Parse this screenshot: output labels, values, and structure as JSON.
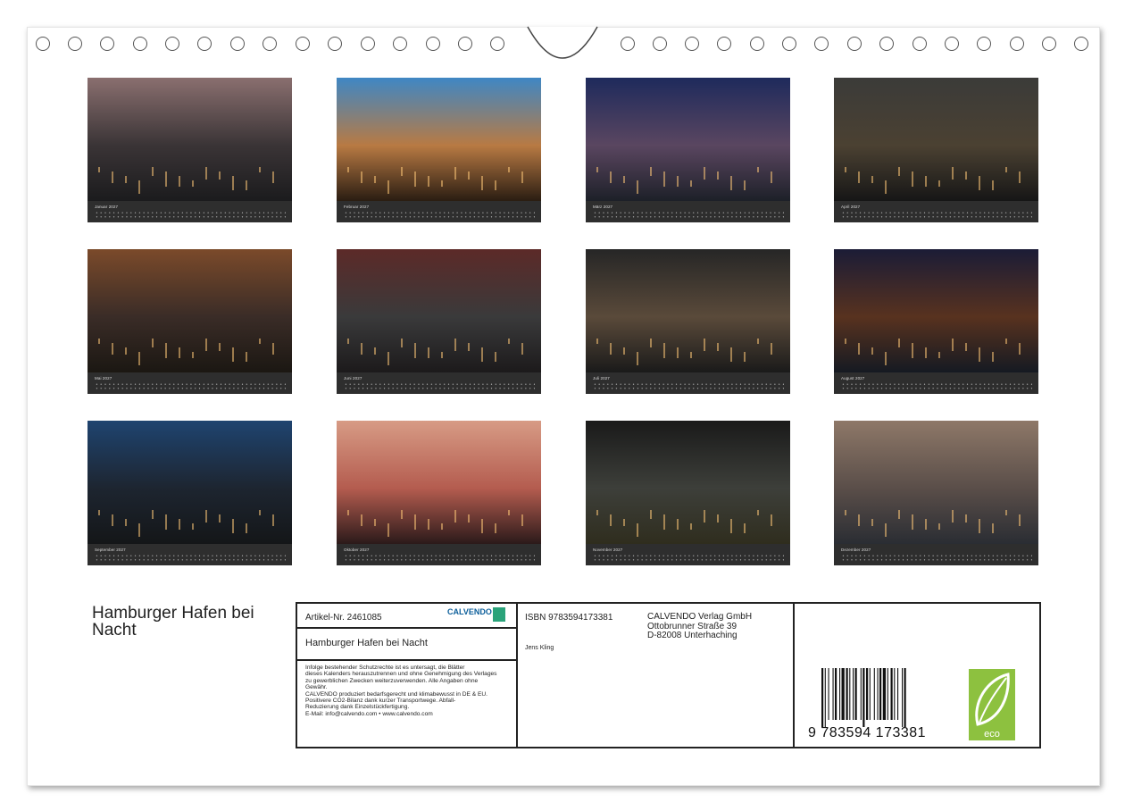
{
  "document_title": "Hamburger Hafen bei Nacht",
  "months": [
    {
      "name": "Januar 2027",
      "colors": [
        "#8a6f6f",
        "#3a3436",
        "#1b1b1d"
      ]
    },
    {
      "name": "Februar 2027",
      "colors": [
        "#3f87c4",
        "#b87a43",
        "#2a1d12"
      ]
    },
    {
      "name": "März 2027",
      "colors": [
        "#1e2a5c",
        "#5a4660",
        "#1d2028"
      ]
    },
    {
      "name": "April 2027",
      "colors": [
        "#3b3b39",
        "#4b4132",
        "#161616"
      ]
    },
    {
      "name": "Mai 2027",
      "colors": [
        "#7b4a2a",
        "#3a2c27",
        "#1b1712"
      ]
    },
    {
      "name": "Juni 2027",
      "colors": [
        "#5c2a28",
        "#3a3a3b",
        "#1c1a1b"
      ]
    },
    {
      "name": "Juli 2027",
      "colors": [
        "#262626",
        "#5a4a3a",
        "#1a1a1a"
      ]
    },
    {
      "name": "August 2027",
      "colors": [
        "#1b1c36",
        "#58321f",
        "#151a22"
      ]
    },
    {
      "name": "September 2027",
      "colors": [
        "#1f4470",
        "#1d2530",
        "#141618"
      ]
    },
    {
      "name": "Oktober 2027",
      "colors": [
        "#d79b85",
        "#b45c4f",
        "#2b1a1a"
      ]
    },
    {
      "name": "November 2027",
      "colors": [
        "#1a1a1a",
        "#3d3f3a",
        "#2f2d1e"
      ]
    },
    {
      "name": "Dezember 2027",
      "colors": [
        "#8e7868",
        "#5a4e49",
        "#2a2d33"
      ]
    }
  ],
  "info": {
    "artikel": "Artikel-Nr. 2461085",
    "brand": "CALVENDO",
    "brand_sub": "Jens Kling",
    "subtitle": "Hamburger Hafen bei Nacht",
    "legal": "Infolge bestehender Schutzrechte ist es untersagt, die Blätter\ndieses Kalenders herauszutrennen und ohne Genehmigung des Verlages\nzu gewerblichen Zwecken weiterzuverwenden. Alle Angaben ohne\nGewähr.\nCALVENDO produziert bedarfsgerecht und klimabewusst in DE & EU.\nPositivere CO2-Bilanz dank kurzer Transportwege. Abfall-\nReduzierung dank Einzelstückfertigung.\nE-Mail: info@calvendo.com • www.calvendo.com",
    "isbn": "ISBN 9783594173381",
    "author": "Jens Kling",
    "publisher": "CALVENDO Verlag GmbH\nOttobrunner Straße 39\nD-82008 Unterhaching",
    "barcode_number": "9 783594 173381",
    "eco_label": "eco",
    "eco_color": "#8dc13f"
  }
}
